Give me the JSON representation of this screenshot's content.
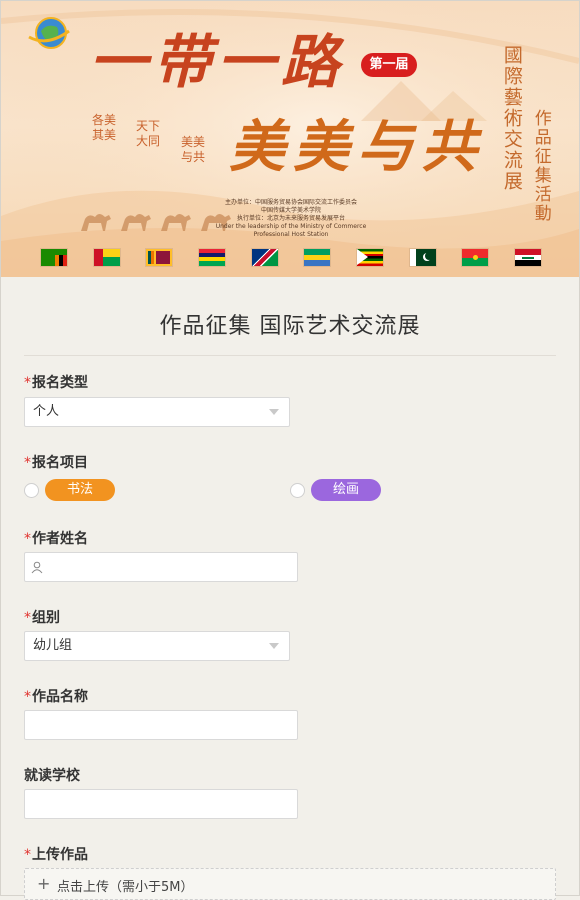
{
  "banner": {
    "title_main": "一带一路",
    "edition": "第一届",
    "title_sub": "美美与共",
    "vertical_1": "國際藝術交流展",
    "vertical_2": "作品征集活動",
    "phrase_1": "各美\n其美",
    "phrase_2": "天下\n大同",
    "phrase_3": "美美\n与共",
    "organizer_1": "主办单位：中国服务贸易协会国际交流工作委员会",
    "organizer_2": "中国传媒大学美术学院",
    "organizer_3": "执行单位：北京为未来服务贸易发展平台",
    "organizer_4": "Under the leadership of the Ministry of Commerce",
    "organizer_5": "Professional Host Station",
    "flags": [
      "zambia-flag",
      "guinea-bissau-flag",
      "sri-lanka-flag",
      "mauritius-flag",
      "namibia-flag",
      "gabon-flag",
      "zimbabwe-flag",
      "pakistan-flag",
      "burkina-faso-flag",
      "iraq-flag"
    ]
  },
  "form": {
    "title": "作品征集 国际艺术交流展",
    "required_mark": "*",
    "reg_type": {
      "label": "报名类型",
      "value": "个人"
    },
    "reg_item": {
      "label": "报名项目",
      "options": [
        {
          "label": "书法",
          "color": "#f29320"
        },
        {
          "label": "绘画",
          "color": "#9b67de"
        }
      ]
    },
    "author_name": {
      "label": "作者姓名",
      "value": ""
    },
    "group": {
      "label": "组别",
      "value": "幼儿组"
    },
    "work_name": {
      "label": "作品名称",
      "value": ""
    },
    "school": {
      "label": "就读学校",
      "value": ""
    },
    "upload": {
      "label": "上传作品",
      "button": "点击上传（需小于5M）"
    }
  },
  "colors": {
    "accent_required": "#e0322e",
    "banner_red": "#c7431e",
    "banner_orange": "#d0691a"
  }
}
